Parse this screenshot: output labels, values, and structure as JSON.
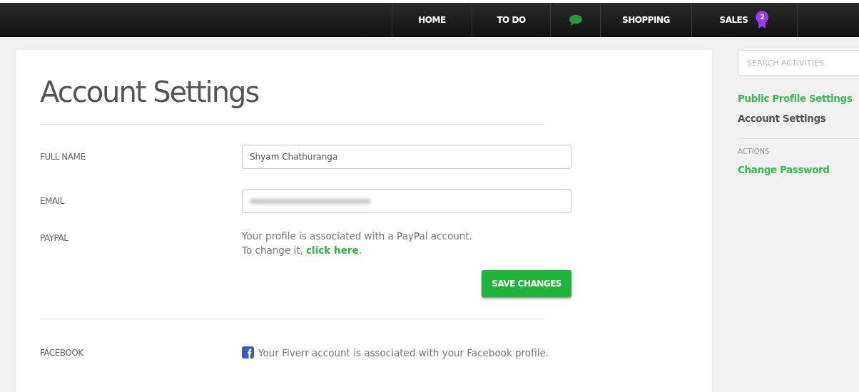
{
  "nav": [
    {
      "kind": "text",
      "label": "HOME"
    },
    {
      "kind": "text",
      "label": "TO DO"
    },
    {
      "kind": "chat"
    },
    {
      "kind": "text",
      "label": "SHOPPING"
    },
    {
      "kind": "badge",
      "label": "SALES",
      "badge": "2"
    }
  ],
  "page": {
    "title": "Account Settings",
    "fields": [
      {
        "label": "FULL NAME",
        "kind": "input",
        "value": "Shyam Chathuranga"
      },
      {
        "label": "EMAIL",
        "kind": "blurred"
      }
    ],
    "paypal": {
      "label": "PAYPAL",
      "line1": "Your profile is associated with a PayPal account.",
      "line2": "To change it, ",
      "link": "click here",
      "suffix": "."
    },
    "save_button": "SAVE CHANGES",
    "facebook": {
      "label": "FACEBOOK",
      "text": "Your Fiverr account is associated with your Facebook profile."
    }
  },
  "sidebar": {
    "search": {
      "placeholder": "SEARCH ACTIVITIES"
    },
    "items": [
      {
        "label": "Public Profile Settings",
        "selected": false
      },
      {
        "label": "Account Settings",
        "selected": true
      }
    ],
    "actions_heading": "ACTIONS",
    "actions": [
      "Change Password"
    ]
  }
}
